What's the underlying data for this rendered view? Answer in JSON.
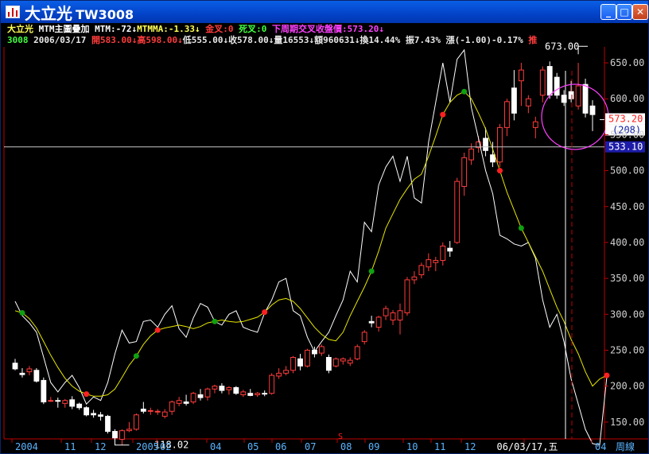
{
  "window": {
    "title": "大立光",
    "code": "TW3008",
    "minimize": "_",
    "maximize": "□",
    "close": "✕"
  },
  "info_line1": {
    "name": "大立光",
    "indicator": "MTM主圖疊加",
    "mtm": "MTM:-72↓",
    "mtmma": "MTMMA:-1.33↓",
    "golden": "金叉:0",
    "death": "死叉:0",
    "next_period": "下周期交叉收盤價:573.20↓"
  },
  "info_line2": {
    "code": "3008",
    "date": "2006/03/17",
    "open": "開583.00↓",
    "high": "高598.00↓",
    "low": "低555.00↓",
    "close": "收578.00↓",
    "volume": "量16553↓",
    "amount": "額960631↓",
    "turnover": "換14.44%",
    "amplitude": "振7.43%",
    "change": "漲(-1.00)-0.17%",
    "tail": "推"
  },
  "colors": {
    "up": "#ff3c3c",
    "down": "#ffffff",
    "mtm": "#ffffff",
    "mtmma": "#e8e800",
    "axis": "#c00000",
    "label": "#d0d0d0",
    "name": "#ffff54",
    "magenta": "#ff40ff",
    "green": "#40ff40"
  },
  "chart_data": {
    "type": "candlestick",
    "y_axis": {
      "min": 100,
      "max": 670,
      "ticks": [
        "650.00",
        "600.00",
        "550.00",
        "500.00",
        "450.00",
        "400.00",
        "350.00",
        "300.00",
        "250.00",
        "200.00",
        "150.00"
      ]
    },
    "x_labels": [
      "2004",
      "11",
      "12",
      "2005",
      "02",
      "04",
      "05",
      "06",
      "07",
      "08",
      "09",
      "10",
      "11",
      "12",
      "06/03/17,五",
      "04"
    ],
    "right_bottom_label": "周線",
    "price_marker": "573.20",
    "count_marker": "(208)",
    "crosshair_value": "533.10",
    "annotations": {
      "high_label": "673.00",
      "low_label": "118.02",
      "event_mark": "S"
    },
    "candles": [
      {
        "o": 232,
        "h": 238,
        "l": 222,
        "c": 224
      },
      {
        "o": 218,
        "h": 225,
        "l": 212,
        "c": 216
      },
      {
        "o": 220,
        "h": 228,
        "l": 215,
        "c": 224
      },
      {
        "o": 222,
        "h": 225,
        "l": 205,
        "c": 207
      },
      {
        "o": 208,
        "h": 212,
        "l": 175,
        "c": 178
      },
      {
        "o": 180,
        "h": 185,
        "l": 178,
        "c": 180
      },
      {
        "o": 180,
        "h": 184,
        "l": 170,
        "c": 179
      },
      {
        "o": 176,
        "h": 182,
        "l": 170,
        "c": 180
      },
      {
        "o": 181,
        "h": 186,
        "l": 168,
        "c": 172
      },
      {
        "o": 175,
        "h": 177,
        "l": 167,
        "c": 170
      },
      {
        "o": 170,
        "h": 172,
        "l": 158,
        "c": 160
      },
      {
        "o": 162,
        "h": 167,
        "l": 156,
        "c": 160
      },
      {
        "o": 160,
        "h": 164,
        "l": 152,
        "c": 158
      },
      {
        "o": 158,
        "h": 160,
        "l": 134,
        "c": 137
      },
      {
        "o": 137,
        "h": 140,
        "l": 123,
        "c": 128
      },
      {
        "o": 126,
        "h": 140,
        "l": 118,
        "c": 138
      },
      {
        "o": 138,
        "h": 150,
        "l": 136,
        "c": 140
      },
      {
        "o": 140,
        "h": 162,
        "l": 138,
        "c": 160
      },
      {
        "o": 168,
        "h": 178,
        "l": 162,
        "c": 165
      },
      {
        "o": 165,
        "h": 170,
        "l": 160,
        "c": 166
      },
      {
        "o": 165,
        "h": 168,
        "l": 160,
        "c": 165
      },
      {
        "o": 158,
        "h": 168,
        "l": 155,
        "c": 164
      },
      {
        "o": 165,
        "h": 180,
        "l": 160,
        "c": 178
      },
      {
        "o": 176,
        "h": 185,
        "l": 172,
        "c": 180
      },
      {
        "o": 178,
        "h": 188,
        "l": 173,
        "c": 176
      },
      {
        "o": 178,
        "h": 192,
        "l": 175,
        "c": 190
      },
      {
        "o": 188,
        "h": 196,
        "l": 180,
        "c": 184
      },
      {
        "o": 185,
        "h": 198,
        "l": 180,
        "c": 196
      },
      {
        "o": 196,
        "h": 202,
        "l": 190,
        "c": 200
      },
      {
        "o": 200,
        "h": 204,
        "l": 190,
        "c": 194
      },
      {
        "o": 195,
        "h": 200,
        "l": 188,
        "c": 198
      },
      {
        "o": 198,
        "h": 200,
        "l": 188,
        "c": 190
      },
      {
        "o": 188,
        "h": 195,
        "l": 185,
        "c": 192
      },
      {
        "o": 190,
        "h": 196,
        "l": 186,
        "c": 187
      },
      {
        "o": 188,
        "h": 192,
        "l": 185,
        "c": 190
      },
      {
        "o": 190,
        "h": 194,
        "l": 186,
        "c": 189
      },
      {
        "o": 190,
        "h": 218,
        "l": 188,
        "c": 215
      },
      {
        "o": 214,
        "h": 225,
        "l": 210,
        "c": 218
      },
      {
        "o": 218,
        "h": 228,
        "l": 215,
        "c": 222
      },
      {
        "o": 222,
        "h": 242,
        "l": 218,
        "c": 240
      },
      {
        "o": 238,
        "h": 245,
        "l": 222,
        "c": 228
      },
      {
        "o": 228,
        "h": 252,
        "l": 226,
        "c": 250
      },
      {
        "o": 250,
        "h": 255,
        "l": 240,
        "c": 245
      },
      {
        "o": 246,
        "h": 258,
        "l": 242,
        "c": 255
      },
      {
        "o": 240,
        "h": 244,
        "l": 218,
        "c": 222
      },
      {
        "o": 228,
        "h": 240,
        "l": 226,
        "c": 238
      },
      {
        "o": 235,
        "h": 240,
        "l": 230,
        "c": 238
      },
      {
        "o": 232,
        "h": 240,
        "l": 228,
        "c": 236
      },
      {
        "o": 238,
        "h": 258,
        "l": 236,
        "c": 255
      },
      {
        "o": 262,
        "h": 278,
        "l": 258,
        "c": 275
      },
      {
        "o": 290,
        "h": 298,
        "l": 282,
        "c": 288
      },
      {
        "o": 282,
        "h": 298,
        "l": 276,
        "c": 296
      },
      {
        "o": 298,
        "h": 312,
        "l": 292,
        "c": 308
      },
      {
        "o": 292,
        "h": 306,
        "l": 285,
        "c": 302
      },
      {
        "o": 292,
        "h": 315,
        "l": 272,
        "c": 305
      },
      {
        "o": 302,
        "h": 352,
        "l": 298,
        "c": 348
      },
      {
        "o": 348,
        "h": 360,
        "l": 342,
        "c": 352
      },
      {
        "o": 355,
        "h": 372,
        "l": 350,
        "c": 368
      },
      {
        "o": 366,
        "h": 385,
        "l": 360,
        "c": 376
      },
      {
        "o": 372,
        "h": 380,
        "l": 360,
        "c": 375
      },
      {
        "o": 375,
        "h": 400,
        "l": 368,
        "c": 395
      },
      {
        "o": 392,
        "h": 402,
        "l": 380,
        "c": 388
      },
      {
        "o": 400,
        "h": 490,
        "l": 398,
        "c": 485
      },
      {
        "o": 478,
        "h": 525,
        "l": 465,
        "c": 518
      },
      {
        "o": 515,
        "h": 538,
        "l": 508,
        "c": 530
      },
      {
        "o": 532,
        "h": 548,
        "l": 525,
        "c": 540
      },
      {
        "o": 545,
        "h": 560,
        "l": 520,
        "c": 528
      },
      {
        "o": 522,
        "h": 540,
        "l": 505,
        "c": 512
      },
      {
        "o": 512,
        "h": 565,
        "l": 505,
        "c": 560
      },
      {
        "o": 560,
        "h": 600,
        "l": 548,
        "c": 596
      },
      {
        "o": 615,
        "h": 640,
        "l": 570,
        "c": 580
      },
      {
        "o": 625,
        "h": 650,
        "l": 590,
        "c": 640
      },
      {
        "o": 590,
        "h": 605,
        "l": 580,
        "c": 600
      },
      {
        "o": 560,
        "h": 575,
        "l": 545,
        "c": 568
      },
      {
        "o": 605,
        "h": 645,
        "l": 595,
        "c": 640
      },
      {
        "o": 645,
        "h": 652,
        "l": 600,
        "c": 605
      },
      {
        "o": 630,
        "h": 636,
        "l": 600,
        "c": 605
      },
      {
        "o": 605,
        "h": 612,
        "l": 590,
        "c": 595
      },
      {
        "o": 610,
        "h": 625,
        "l": 595,
        "c": 600
      },
      {
        "o": 590,
        "h": 650,
        "l": 585,
        "c": 618
      },
      {
        "o": 620,
        "h": 628,
        "l": 574,
        "c": 580
      },
      {
        "o": 590,
        "h": 598,
        "l": 555,
        "c": 578
      }
    ],
    "mtm_series": [
      318,
      298,
      288,
      275,
      240,
      205,
      192,
      205,
      215,
      198,
      175,
      185,
      180,
      205,
      245,
      278,
      260,
      262,
      290,
      292,
      282,
      300,
      312,
      280,
      268,
      295,
      315,
      310,
      290,
      285,
      300,
      305,
      282,
      278,
      275,
      302,
      320,
      345,
      350,
      305,
      298,
      268,
      248,
      262,
      275,
      298,
      320,
      360,
      345,
      428,
      415,
      480,
      505,
      520,
      485,
      520,
      462,
      455,
      540,
      595,
      650,
      595,
      655,
      668,
      588,
      545,
      500,
      468,
      410,
      405,
      398,
      395,
      400,
      378,
      320,
      282,
      300,
      262,
      210,
      175,
      140,
      120,
      118,
      212
    ],
    "mtmma_series": [
      305,
      302,
      294,
      281,
      262,
      243,
      226,
      211,
      200,
      193,
      189,
      186,
      186,
      188,
      196,
      212,
      229,
      242,
      258,
      270,
      278,
      281,
      283,
      285,
      283,
      280,
      283,
      288,
      290,
      292,
      290,
      289,
      290,
      293,
      296,
      303,
      313,
      320,
      322,
      318,
      308,
      295,
      282,
      272,
      265,
      263,
      275,
      298,
      318,
      338,
      360,
      388,
      420,
      440,
      460,
      475,
      488,
      495,
      520,
      548,
      578,
      595,
      605,
      610,
      600,
      580,
      558,
      530,
      500,
      470,
      445,
      420,
      400,
      380,
      360,
      335,
      310,
      290,
      265,
      245,
      220,
      200,
      210,
      215
    ],
    "cross_markers": [
      {
        "i": 1,
        "type": "golden"
      },
      {
        "i": 10,
        "type": "death"
      },
      {
        "i": 17,
        "type": "golden"
      },
      {
        "i": 20,
        "type": "death"
      },
      {
        "i": 28,
        "type": "golden"
      },
      {
        "i": 35,
        "type": "death"
      },
      {
        "i": 50,
        "type": "golden"
      },
      {
        "i": 60,
        "type": "death"
      },
      {
        "i": 63,
        "type": "golden"
      },
      {
        "i": 68,
        "type": "death"
      },
      {
        "i": 71,
        "type": "golden"
      },
      {
        "i": 83,
        "type": "death"
      }
    ]
  }
}
